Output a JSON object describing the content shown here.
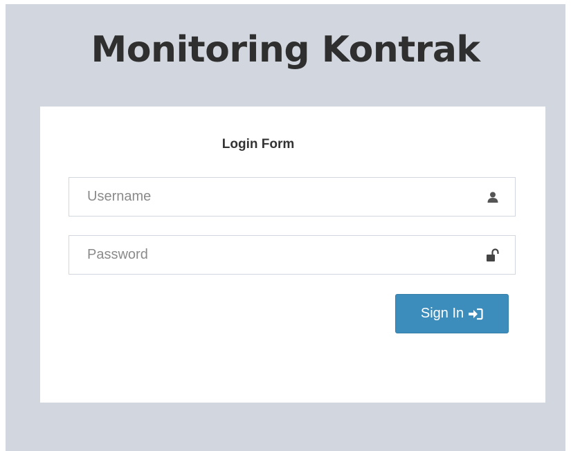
{
  "app": {
    "title": "Monitoring Kontrak"
  },
  "login": {
    "form_title": "Login Form",
    "username": {
      "placeholder": "Username",
      "value": "",
      "icon": "user-icon"
    },
    "password": {
      "placeholder": "Password",
      "value": "",
      "icon": "unlock-icon"
    },
    "submit": {
      "label": "Sign In",
      "icon": "sign-in-icon"
    }
  },
  "colors": {
    "background": "#d2d6de",
    "card": "#ffffff",
    "primary_button": "#3c8dbc",
    "title_text": "#2f2f2f"
  }
}
